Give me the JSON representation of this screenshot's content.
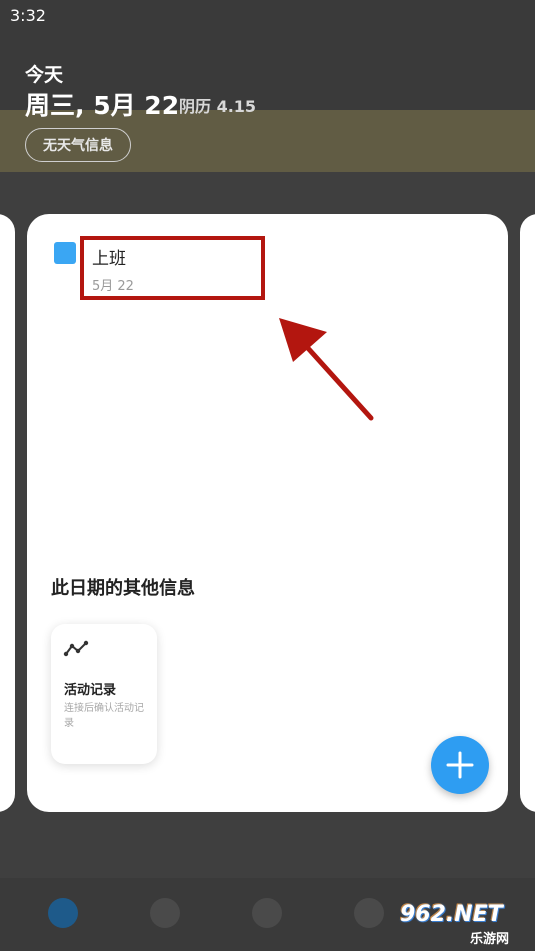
{
  "status_bar": {
    "time": "3:32"
  },
  "header": {
    "today_label": "今天",
    "date": "周三, 5月 22",
    "lunar": "阴历 4.15",
    "weather_chip": "无天气信息"
  },
  "event": {
    "title": "上班",
    "date": "5月 22",
    "color": "#3aa6f3"
  },
  "other_info": {
    "section_title": "此日期的其他信息",
    "activity_card": {
      "icon": "activity-chart-icon",
      "title": "活动记录",
      "description": "连接后确认活动记录"
    }
  },
  "fab": {
    "icon": "plus-icon",
    "color": "#2e9df2"
  },
  "annotation": {
    "highlight_color": "#b3160f"
  },
  "watermark": {
    "logo": "962.NET",
    "sub": "乐游网"
  }
}
